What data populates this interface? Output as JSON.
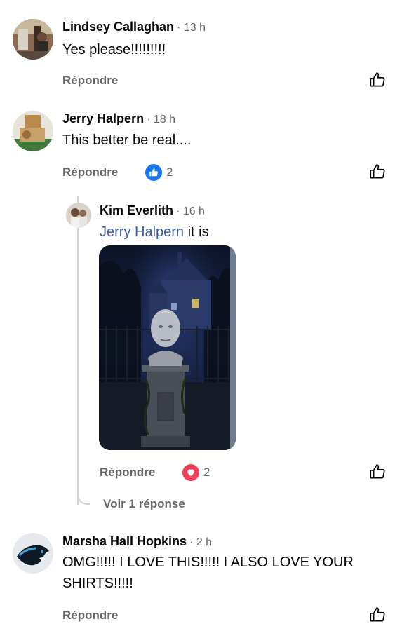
{
  "comments": [
    {
      "author": "Lindsey Callaghan",
      "time": "· 13 h",
      "text": "Yes please!!!!!!!!!",
      "reply_label": "Répondre"
    },
    {
      "author": "Jerry Halpern",
      "time": "· 18 h",
      "text": "This better be real....",
      "reply_label": "Répondre",
      "reaction_count": "2",
      "reaction_type": "like"
    },
    {
      "author": "Kim Everlith",
      "time": "· 16 h",
      "mention": "Jerry Halpern",
      "text": " it is",
      "reply_label": "Répondre",
      "reaction_count": "2",
      "reaction_type": "love",
      "see_replies": "Voir 1 réponse"
    },
    {
      "author": "Marsha Hall Hopkins",
      "time": "· 2 h",
      "text_line1": "OMG!!!!! I LOVE THIS!!!!! I ALSO LOVE YOUR",
      "text_line2": "SHIRTS!!!!!",
      "reply_label": "Répondre"
    }
  ],
  "icons": {
    "like": "thumbs-up-outline-icon",
    "like_reaction": "like-reaction-icon",
    "love_reaction": "heart-reaction-icon"
  },
  "colors": {
    "like_blue": "#1877f2",
    "love_red": "#f33e58",
    "mention": "#3b5ba5",
    "meta_gray": "#65676b"
  }
}
